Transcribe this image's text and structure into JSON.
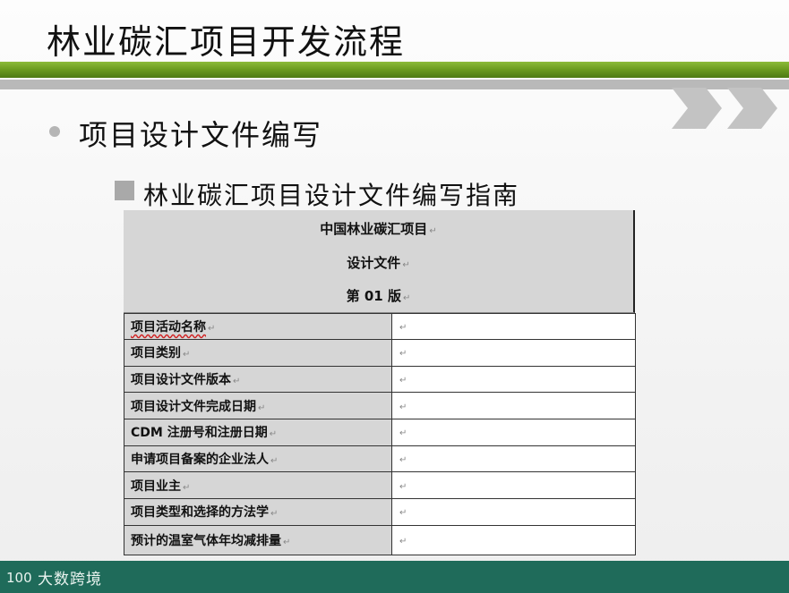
{
  "slide": {
    "title": "林业碳汇项目开发流程",
    "bullet": "项目设计文件编写",
    "sub_bullet": "林业碳汇项目设计文件编写指南"
  },
  "document": {
    "header_lines": [
      "中国林业碳汇项目",
      "设计文件",
      "第 01 版"
    ],
    "paragraph_mark": "↵",
    "rows": [
      {
        "label": "项目活动名称",
        "value": ""
      },
      {
        "label": "项目类别",
        "value": ""
      },
      {
        "label": "项目设计文件版本",
        "value": ""
      },
      {
        "label": "项目设计文件完成日期",
        "value": ""
      },
      {
        "label": "CDM 注册号和注册日期",
        "value": ""
      },
      {
        "label": "申请项目备案的企业法人",
        "value": ""
      },
      {
        "label": "项目业主",
        "value": ""
      },
      {
        "label": "项目类型和选择的方法学",
        "value": ""
      },
      {
        "label": "预计的温室气体年均减排量",
        "value": ""
      }
    ]
  },
  "footer": {
    "brand": "大数跨境",
    "logo_text": "100"
  },
  "colors": {
    "green_bar": "#6a9a1f",
    "gray_bar": "#b9b9b9",
    "footer": "#1f6b5a",
    "table_label_bg": "#d6d6d6"
  },
  "icons": {
    "decor": "double-chevron-right-icon",
    "bullet": "bullet-dot-icon",
    "sub_bullet": "square-bullet-icon",
    "logo": "brand-logo-icon"
  }
}
